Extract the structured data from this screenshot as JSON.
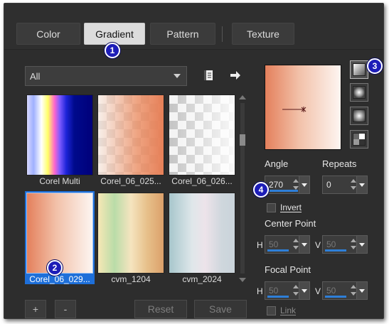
{
  "tabs": [
    {
      "label": "Color"
    },
    {
      "label": "Gradient"
    },
    {
      "label": "Pattern"
    },
    {
      "label": "Texture"
    }
  ],
  "active_tab": "Gradient",
  "callouts": [
    "1",
    "2",
    "3",
    "4"
  ],
  "category_dropdown": {
    "selected": "All"
  },
  "swatches": [
    {
      "label": "Corel Multi",
      "selected": false
    },
    {
      "label": "Corel_06_025...",
      "selected": false
    },
    {
      "label": "Corel_06_026...",
      "selected": false
    },
    {
      "label": "Corel_06_029...",
      "selected": true
    },
    {
      "label": "cvm_1204",
      "selected": false
    },
    {
      "label": "cvm_2024",
      "selected": false
    }
  ],
  "bottom_buttons": {
    "add": "+",
    "remove": "-",
    "reset": "Reset",
    "save": "Save"
  },
  "angle": {
    "label": "Angle",
    "value": "270"
  },
  "repeats": {
    "label": "Repeats",
    "value": "0"
  },
  "invert": {
    "label": "Invert",
    "checked": false
  },
  "center_point": {
    "label": "Center Point",
    "h_label": "H",
    "h_value": "50",
    "v_label": "V",
    "v_value": "50"
  },
  "focal_point": {
    "label": "Focal Point",
    "h_label": "H",
    "h_value": "50",
    "v_label": "V",
    "v_value": "50"
  },
  "link": {
    "label": "Link",
    "checked": false
  },
  "colors": {
    "accent": "#1e6fd9",
    "callout": "#1d1db8",
    "panel": "#2d2d2d"
  }
}
